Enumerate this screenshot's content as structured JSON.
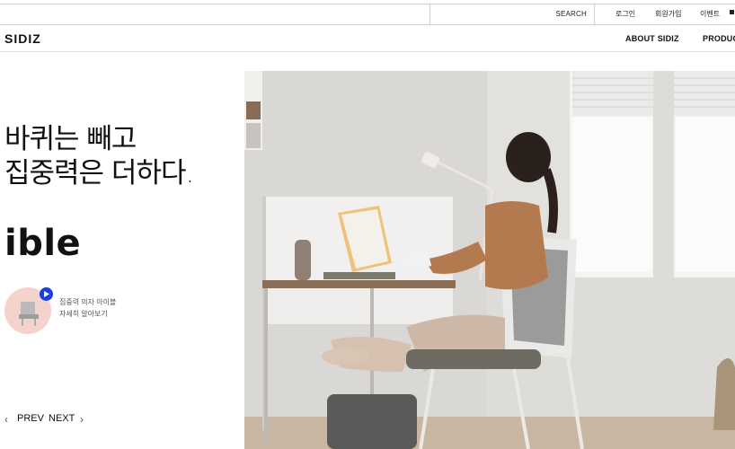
{
  "topbar": {
    "search_label": "SEARCH",
    "utility_links": [
      "로그인",
      "회원가입",
      "이벤트"
    ]
  },
  "header": {
    "logo": "SIDIZ",
    "nav": [
      "ABOUT SIDIZ",
      "PRODUCT"
    ]
  },
  "hero": {
    "headline_line1": "바퀴는 빼고",
    "headline_line2": "집중력은 더하다.",
    "big_word": "ible",
    "video_caption_line1": "집중력 의자 아이블",
    "video_caption_line2": "자세히 알아보기",
    "prev_label": "PREV",
    "next_label": "NEXT"
  },
  "colors": {
    "accent": "#1c3fd6",
    "thumb_bg": "#f3d3cc",
    "wall": "#e4e3df",
    "floor": "#c9b8a4"
  }
}
